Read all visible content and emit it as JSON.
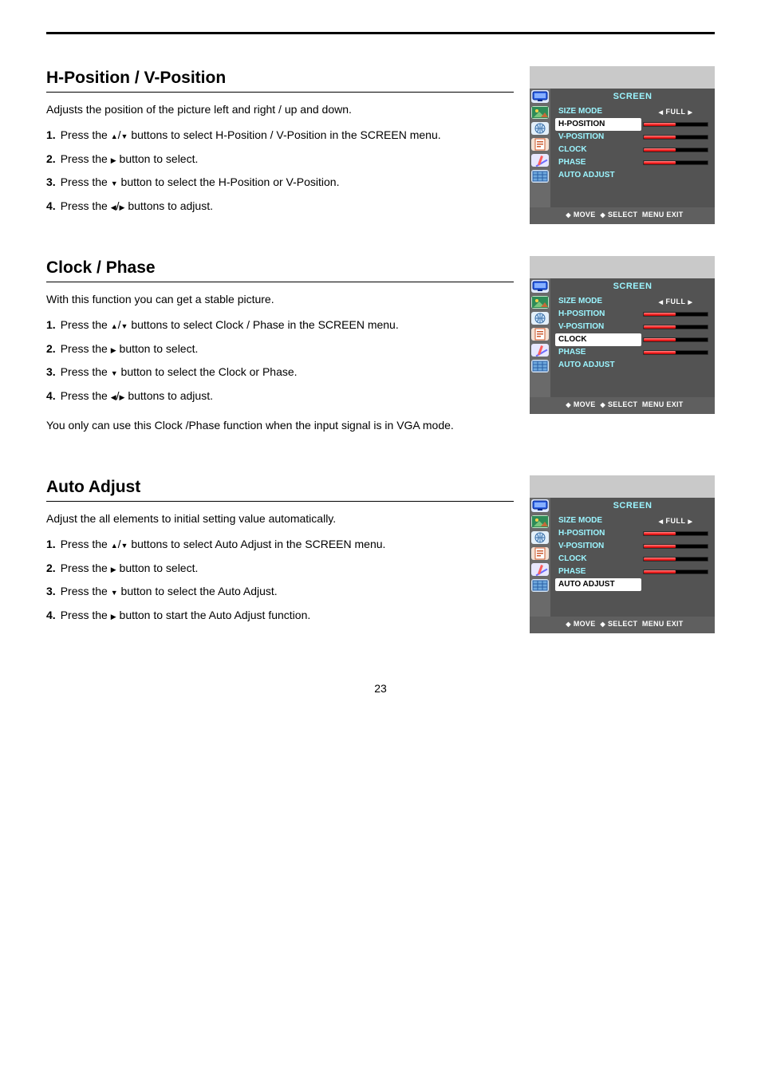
{
  "sections": {
    "hv": {
      "heading": "H-Position / V-Position",
      "intro": "Adjusts the position of the picture left and right / up and down.",
      "steps": [
        "Press the ▲/▼ buttons to select H-Position / V-Position in the SCREEN menu.",
        "Press the ▶ button to select.",
        "Press the ▼ button to select the H-Position or V-Position.",
        "Press the ◀/▶ buttons to adjust."
      ],
      "selected": "H-POSITION"
    },
    "cp": {
      "heading": "Clock / Phase",
      "intro": "With this function you can get a stable picture.",
      "steps": [
        "Press the ▲/▼ buttons to select Clock / Phase in the SCREEN menu.",
        "Press the ▶ button to select.",
        "Press the ▼ button to select the Clock or Phase.",
        "Press the ◀/▶ buttons to adjust."
      ],
      "note": "You only can use this Clock /Phase function when the input signal is in VGA mode.",
      "selected": "CLOCK"
    },
    "auto": {
      "heading": "Auto Adjust",
      "intro": "Adjust the all elements to initial setting value automatically.",
      "steps": [
        "Press the ▲/▼ buttons to select Auto Adjust in the SCREEN menu.",
        "Press the ▶ button to select.",
        "Press the ▼ button to select the Auto Adjust.",
        "Press the ▶ button to start the Auto Adjust function."
      ],
      "selected": "AUTO ADJUST"
    }
  },
  "osd": {
    "title": "SCREEN",
    "items": [
      {
        "label": "SIZE MODE",
        "kind": "value",
        "value": "FULL"
      },
      {
        "label": "H-POSITION",
        "kind": "slider",
        "pct": 50
      },
      {
        "label": "V-POSITION",
        "kind": "slider",
        "pct": 50
      },
      {
        "label": "CLOCK",
        "kind": "slider",
        "pct": 50
      },
      {
        "label": "PHASE",
        "kind": "slider",
        "pct": 50
      },
      {
        "label": "AUTO ADJUST",
        "kind": "none"
      }
    ],
    "footer": {
      "move": "MOVE",
      "select": "SELECT",
      "menu_exit": "MENU EXIT"
    }
  },
  "page_number": "23"
}
